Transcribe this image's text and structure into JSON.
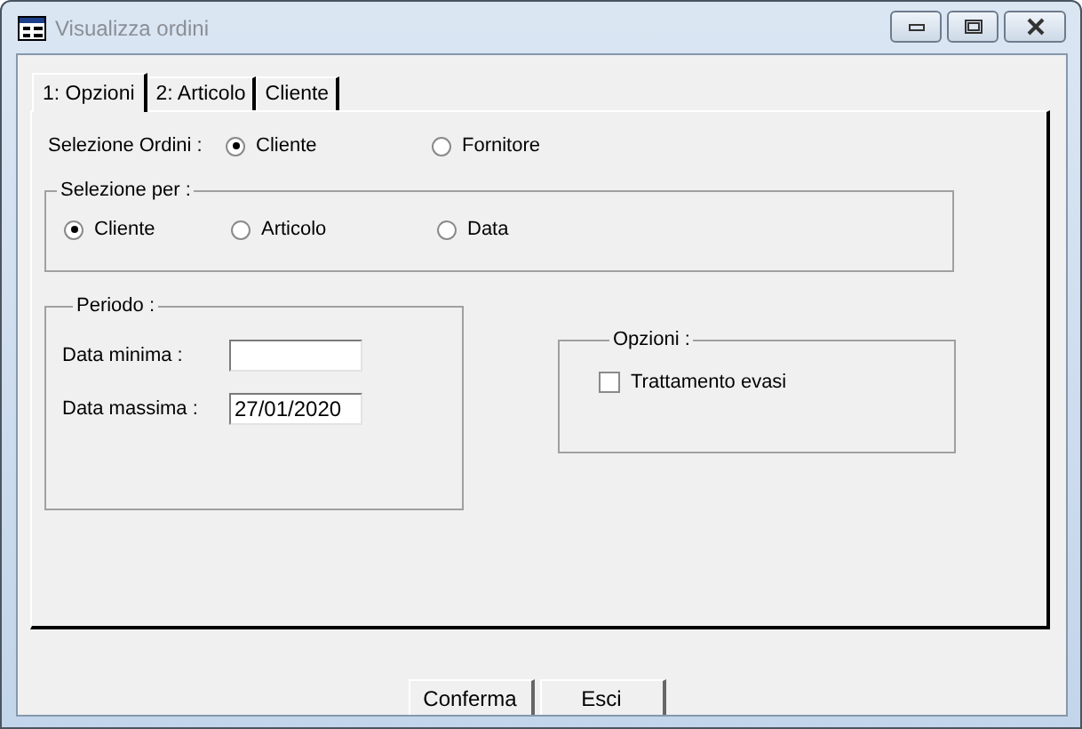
{
  "window": {
    "title": "Visualizza ordini"
  },
  "tabs": [
    {
      "label": "1: Opzioni",
      "selected": true
    },
    {
      "label": "2: Articolo",
      "selected": false
    },
    {
      "label": "Cliente",
      "selected": false
    }
  ],
  "selezione_ordini": {
    "label": "Selezione  Ordini :",
    "options": [
      {
        "label": "Cliente",
        "selected": true
      },
      {
        "label": "Fornitore",
        "selected": false
      }
    ]
  },
  "selezione_per": {
    "title": "Selezione per :",
    "options": [
      {
        "label": "Cliente",
        "selected": true
      },
      {
        "label": "Articolo",
        "selected": false
      },
      {
        "label": "Data",
        "selected": false
      }
    ]
  },
  "periodo": {
    "title": "Periodo :",
    "fields": [
      {
        "label": "Data minima :"
      },
      {
        "label": "Data massima :",
        "value": "27/01/2020"
      }
    ]
  },
  "opzioni": {
    "title": "Opzioni :",
    "checkboxes": [
      {
        "label": "Trattamento evasi",
        "checked": false
      }
    ]
  },
  "buttons": [
    "Conferma",
    "Esci"
  ]
}
